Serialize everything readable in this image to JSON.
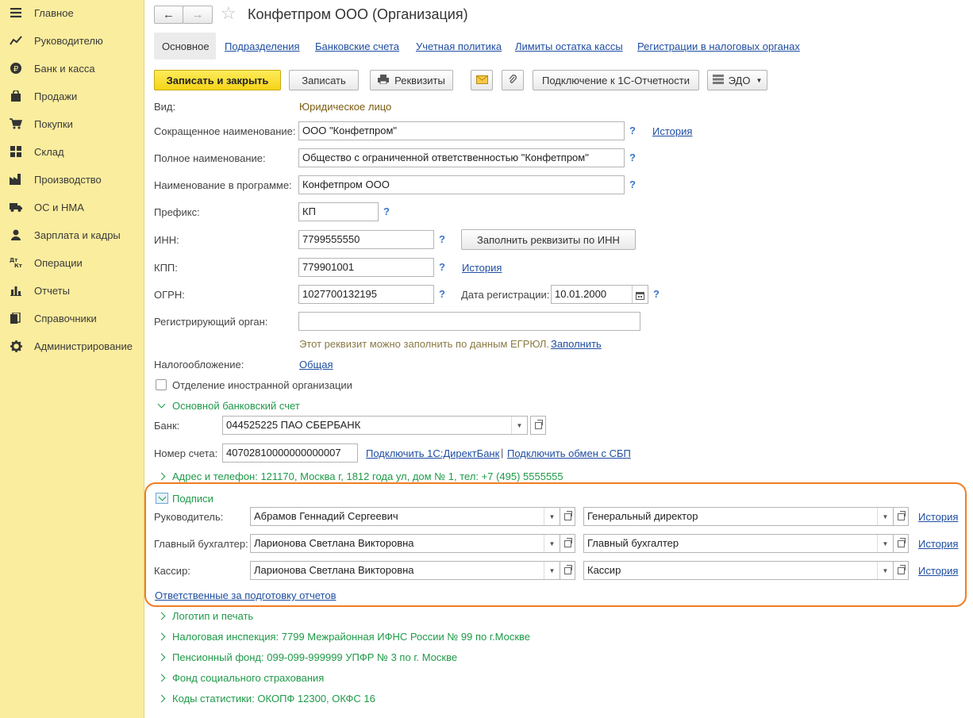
{
  "sidebar": {
    "items": [
      {
        "label": "Главное",
        "icon": "menu-icon"
      },
      {
        "label": "Руководителю",
        "icon": "chart-line-icon"
      },
      {
        "label": "Банк и касса",
        "icon": "ruble-icon"
      },
      {
        "label": "Продажи",
        "icon": "bag-icon"
      },
      {
        "label": "Покупки",
        "icon": "cart-icon"
      },
      {
        "label": "Склад",
        "icon": "grid-icon"
      },
      {
        "label": "Производство",
        "icon": "factory-icon"
      },
      {
        "label": "ОС и НМА",
        "icon": "truck-icon"
      },
      {
        "label": "Зарплата и кадры",
        "icon": "person-icon"
      },
      {
        "label": "Операции",
        "icon": "dt-kt-icon"
      },
      {
        "label": "Отчеты",
        "icon": "bar-chart-icon"
      },
      {
        "label": "Справочники",
        "icon": "books-icon"
      },
      {
        "label": "Администрирование",
        "icon": "gear-icon"
      }
    ]
  },
  "header": {
    "title": "Конфетпром ООО (Организация)"
  },
  "tabs": [
    "Основное",
    "Подразделения",
    "Банковские счета",
    "Учетная политика",
    "Лимиты остатка кассы",
    "Регистрации в налоговых органах"
  ],
  "toolbar": {
    "save_close": "Записать и закрыть",
    "save": "Записать",
    "requisites": "Реквизиты",
    "connect_reporting": "Подключение к 1С-Отчетности",
    "edo": "ЭДО"
  },
  "form": {
    "vid_label": "Вид:",
    "vid_value": "Юридическое лицо",
    "short_name_label": "Сокращенное наименование:",
    "short_name_value": "ООО \"Конфетпром\"",
    "history": "История",
    "full_name_label": "Полное наименование:",
    "full_name_value": "Общество с ограниченной ответственностью \"Конфетпром\"",
    "program_name_label": "Наименование в программе:",
    "program_name_value": "Конфетпром ООО",
    "prefix_label": "Префикс:",
    "prefix_value": "КП",
    "inn_label": "ИНН:",
    "inn_value": "7799555550",
    "fill_by_inn": "Заполнить реквизиты по ИНН",
    "kpp_label": "КПП:",
    "kpp_value": "779901001",
    "ogrn_label": "ОГРН:",
    "ogrn_value": "1027700132195",
    "reg_date_label": "Дата регистрации:",
    "reg_date_value": "10.01.2000",
    "reg_org_label": "Регистрирующий орган:",
    "reg_org_value": "",
    "egrul_hint": "Этот реквизит можно заполнить по данным ЕГРЮЛ.",
    "fill_link": "Заполнить",
    "tax_label": "Налогообложение:",
    "tax_value": "Общая",
    "foreign_branch": "Отделение иностранной организации",
    "q": "?"
  },
  "bank": {
    "section": "Основной банковский счет",
    "bank_label": "Банк:",
    "bank_value": "044525225 ПАО СБЕРБАНК",
    "account_label": "Номер счета:",
    "account_value": "40702810000000000007",
    "connect_direct": "Подключить 1С:ДиректБанк",
    "separator": "|",
    "connect_sbp": "Подключить обмен с СБП"
  },
  "address_section": "Адрес и телефон: 121170, Москва г, 1812 года ул, дом № 1, тел: +7 (495) 5555555",
  "signatures": {
    "section": "Подписи",
    "rows": [
      {
        "label": "Руководитель:",
        "person": "Абрамов Геннадий Сергеевич",
        "position": "Генеральный директор",
        "history": "История"
      },
      {
        "label": "Главный бухгалтер:",
        "person": "Ларионова Светлана Викторовна",
        "position": "Главный бухгалтер",
        "history": "История"
      },
      {
        "label": "Кассир:",
        "person": "Ларионова Светлана Викторовна",
        "position": "Кассир",
        "history": "История"
      }
    ],
    "responsible_link": "Ответственные за подготовку отчетов"
  },
  "sections": [
    "Логотип и печать",
    "Налоговая инспекция: 7799 Межрайонная ИФНС России № 99 по г.Москве",
    "Пенсионный фонд: 099-099-999999 УПФР № 3 по г. Москве",
    "Фонд социального страхования",
    "Коды статистики: ОКОПФ 12300, ОКФС 16"
  ],
  "colors": {
    "sidebar_bg": "#fbed9e",
    "accent_yellow": "#f5d418",
    "link_blue": "#1f4ea1",
    "section_green": "#1f9a49",
    "highlight_orange": "#f07d22"
  }
}
